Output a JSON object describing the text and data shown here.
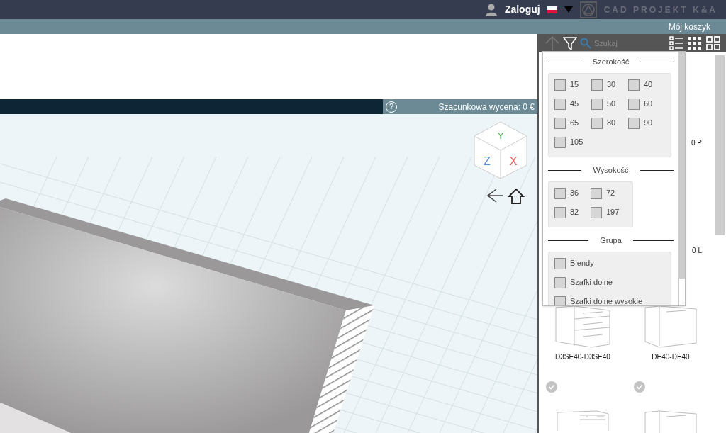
{
  "top_bar": {
    "login": "Zaloguj",
    "logo_text": "CAD PROJEKT K&A"
  },
  "cart_bar": {
    "cart": "Mój koszyk"
  },
  "estimate_bar": {
    "help": "?",
    "estimate": "Szacunkowa wycena: 0 €"
  },
  "viewcube": {
    "axes": [
      {
        "label": "Y",
        "color": "#4caf50"
      },
      {
        "label": "Z",
        "color": "#5b8fd9"
      },
      {
        "label": "X",
        "color": "#e05555"
      }
    ]
  },
  "catalog": {
    "search": {
      "placeholder": "Szukaj"
    },
    "filters": [
      {
        "title": "Szerokość",
        "kind": "wide-grid",
        "options": [
          {
            "label": "15",
            "checked": false
          },
          {
            "label": "30",
            "checked": false
          },
          {
            "label": "40",
            "checked": false
          },
          {
            "label": "45",
            "checked": false
          },
          {
            "label": "50",
            "checked": false
          },
          {
            "label": "60",
            "checked": false
          },
          {
            "label": "65",
            "checked": false
          },
          {
            "label": "80",
            "checked": false
          },
          {
            "label": "90",
            "checked": false
          },
          {
            "label": "105",
            "checked": false
          }
        ]
      },
      {
        "title": "Wysokość",
        "kind": "narrow-grid",
        "options": [
          {
            "label": "36",
            "checked": false
          },
          {
            "label": "72",
            "checked": false
          },
          {
            "label": "82",
            "checked": false
          },
          {
            "label": "197",
            "checked": false
          }
        ]
      },
      {
        "title": "Grupa",
        "kind": "list",
        "options": [
          {
            "label": "Blendy",
            "checked": false
          },
          {
            "label": "Szafki dolne",
            "checked": false
          },
          {
            "label": "Szafki dolne wysokie",
            "checked": false
          }
        ]
      }
    ],
    "partial_labels": [
      "0 P",
      "0 L"
    ],
    "products": [
      {
        "name": "D3SE40-D3SE40",
        "kind": "drawers",
        "checked": false
      },
      {
        "name": "DE40-DE40",
        "kind": "door",
        "checked": false
      },
      {
        "kind": "appliance",
        "checked": true
      },
      {
        "kind": "door",
        "checked": true
      }
    ]
  }
}
